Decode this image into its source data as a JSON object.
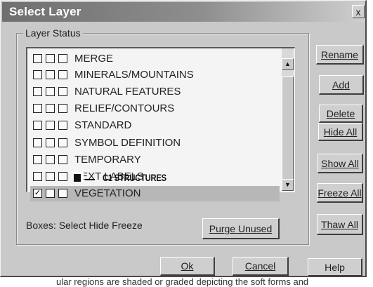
{
  "window": {
    "title": "Select Layer",
    "close_symbol": "x"
  },
  "group": {
    "label": "Layer Status"
  },
  "layers": [
    {
      "name": "MERGE",
      "select": false,
      "hide": false,
      "freeze": false
    },
    {
      "name": "MINERALS/MOUNTAINS",
      "select": false,
      "hide": false,
      "freeze": false
    },
    {
      "name": "NATURAL FEATURES",
      "select": false,
      "hide": false,
      "freeze": false
    },
    {
      "name": "RELIEF/CONTOURS",
      "select": false,
      "hide": false,
      "freeze": false
    },
    {
      "name": "STANDARD",
      "select": false,
      "hide": false,
      "freeze": false
    },
    {
      "name": "SYMBOL DEFINITION",
      "select": false,
      "hide": false,
      "freeze": false
    },
    {
      "name": "TEMPORARY",
      "select": false,
      "hide": false,
      "freeze": false
    },
    {
      "name": "TEXT LABELS",
      "select": false,
      "hide": false,
      "freeze": false
    },
    {
      "name": "VEGETATION",
      "select": true,
      "hide": false,
      "freeze": false,
      "selected": true
    }
  ],
  "overlay": {
    "text": "C1  STRUCTURES"
  },
  "hint": "Boxes: Select Hide Freeze",
  "buttons": {
    "rename": "Rename",
    "add": "Add",
    "delete": "Delete",
    "hide_all": "Hide All",
    "show_all": "Show All",
    "freeze_all": "Freeze All",
    "thaw_all": "Thaw All",
    "purge_unused": "Purge Unused",
    "ok": "Ok",
    "cancel": "Cancel",
    "help": "Help"
  },
  "scrollbar": {
    "up_icon": "up-arrow",
    "down_icon": "down-arrow"
  },
  "below_text": "ular regions are shaded or graded depicting the soft forms and"
}
